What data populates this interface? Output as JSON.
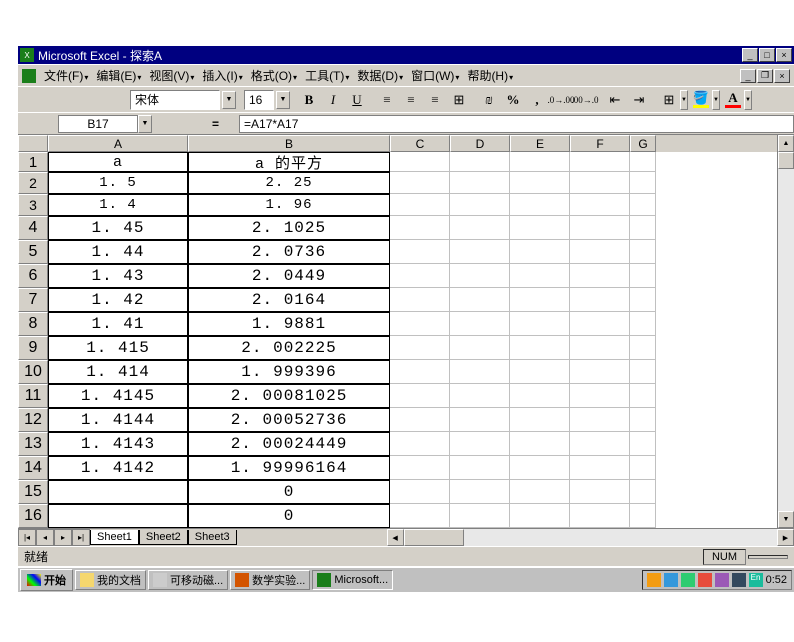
{
  "title": "Microsoft Excel - 探索A",
  "menus": {
    "file": "文件(F)",
    "edit": "编辑(E)",
    "view": "视图(V)",
    "insert": "插入(I)",
    "format": "格式(O)",
    "tools": "工具(T)",
    "data": "数据(D)",
    "window": "窗口(W)",
    "help": "帮助(H)"
  },
  "toolbar": {
    "font_name": "宋体",
    "font_size": "16"
  },
  "formula": {
    "cell_ref": "B17",
    "formula": "=A17*A17"
  },
  "columns": [
    "A",
    "B",
    "C",
    "D",
    "E",
    "F",
    "G"
  ],
  "row_numbers": [
    1,
    2,
    3,
    4,
    5,
    6,
    7,
    8,
    9,
    10,
    11,
    12,
    13,
    14,
    15,
    16
  ],
  "rows": [
    {
      "a": "a",
      "b": "a 的平方"
    },
    {
      "a": "1. 5",
      "b": "2. 25"
    },
    {
      "a": "1. 4",
      "b": "1. 96"
    },
    {
      "a": "1. 45",
      "b": "2. 1025"
    },
    {
      "a": "1. 44",
      "b": "2. 0736"
    },
    {
      "a": "1. 43",
      "b": "2. 0449"
    },
    {
      "a": "1. 42",
      "b": "2. 0164"
    },
    {
      "a": "1. 41",
      "b": "1. 9881"
    },
    {
      "a": "1. 415",
      "b": "2. 002225"
    },
    {
      "a": "1. 414",
      "b": "1. 999396"
    },
    {
      "a": "1. 4145",
      "b": "2. 00081025"
    },
    {
      "a": "1. 4144",
      "b": "2. 00052736"
    },
    {
      "a": "1. 4143",
      "b": "2. 00024449"
    },
    {
      "a": "1. 4142",
      "b": "1. 99996164"
    },
    {
      "a": "",
      "b": "0"
    },
    {
      "a": "",
      "b": "0"
    }
  ],
  "sheets": {
    "s1": "Sheet1",
    "s2": "Sheet2",
    "s3": "Sheet3"
  },
  "status": {
    "ready": "就绪",
    "num": "NUM"
  },
  "taskbar": {
    "start": "开始",
    "docs": "我的文档",
    "removable": "可移动磁...",
    "math": "数学实验...",
    "excel": "Microsoft...",
    "clock": "0:52"
  }
}
